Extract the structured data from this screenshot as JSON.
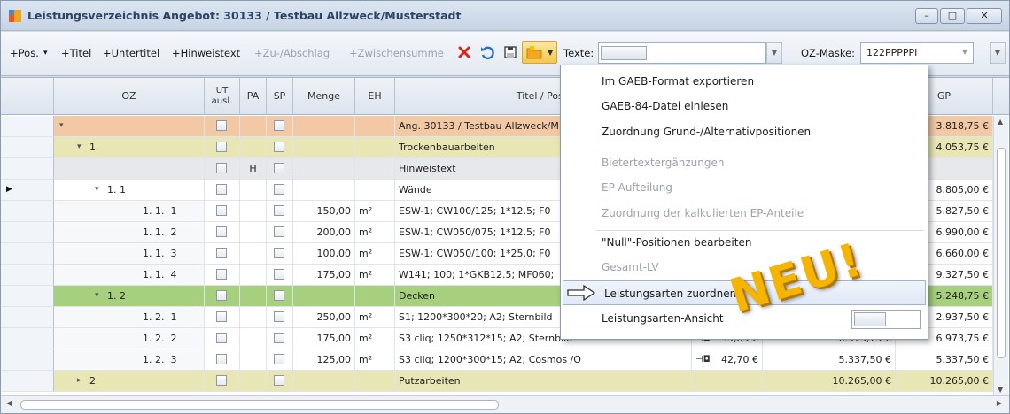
{
  "window": {
    "title": "Leistungsverzeichnis Angebot: 30133 / Testbau Allzweck/Musterstadt",
    "controls": {
      "minimize": "–",
      "maximize": "□",
      "close": "✕"
    }
  },
  "toolbar": {
    "items": [
      {
        "label": "+Pos.",
        "enabled": true
      },
      {
        "label": "▾",
        "enabled": true
      },
      {
        "label": "+Titel",
        "enabled": true
      },
      {
        "label": "+Untertitel",
        "enabled": true
      },
      {
        "label": "+Hinweistext",
        "enabled": true
      },
      {
        "label": "+Zu-/Abschlag",
        "enabled": false
      },
      {
        "label": "+Zwischensumme",
        "enabled": false
      }
    ],
    "icons": [
      "delete-icon",
      "undo-icon",
      "save-icon",
      "folder-icon"
    ],
    "texte_label": "Texte:",
    "texte_value": "",
    "oz_maske_label": "OZ-Maske:",
    "oz_maske_value": "122PPPPPI"
  },
  "columns": {
    "oz": "OZ",
    "ut_ausl": "UT\nausl.",
    "pa": "PA",
    "sp": "SP",
    "menge": "Menge",
    "eh": "EH",
    "titel": "Titel / Posit",
    "gp": "GP"
  },
  "rows": [
    {
      "oz": "",
      "expander": "▾",
      "level": 0,
      "menge": "",
      "eh": "",
      "titel": "Ang. 30133 / Testbau Allzweck/M",
      "ep": "",
      "gp_mid": "",
      "gp": "3.818,75 €",
      "pa": "",
      "bg": "#f2c9a4"
    },
    {
      "oz": "1",
      "expander": "▾",
      "level": 1,
      "menge": "",
      "eh": "",
      "titel": "Trockenbauarbeiten",
      "ep": "",
      "gp_mid": "",
      "gp": "4.053,75 €",
      "pa": "",
      "bg": "#e8e6b4"
    },
    {
      "oz": "",
      "expander": "",
      "level": 2,
      "menge": "",
      "eh": "",
      "titel": "Hinweistext",
      "ep": "",
      "gp_mid": "",
      "gp": "",
      "pa": "H",
      "bg": "#e6e8ec"
    },
    {
      "oz": "1. 1",
      "expander": "▾",
      "level": 2,
      "menge": "",
      "eh": "",
      "titel": "Wände",
      "ep": "",
      "gp_mid": "",
      "gp": "8.805,00 €",
      "pa": "",
      "bg": "#ffffff",
      "current": true
    },
    {
      "oz": "1. 1.  1",
      "expander": "",
      "level": 3,
      "menge": "150,00",
      "eh": "m²",
      "titel": "ESW-1; CW100/125; 1*12.5; F0",
      "ep": "",
      "gp_mid": "",
      "gp": "5.827,50 €",
      "pa": "",
      "bg": "#f7f8fa"
    },
    {
      "oz": "1. 1.  2",
      "expander": "",
      "level": 3,
      "menge": "200,00",
      "eh": "m²",
      "titel": "ESW-1; CW050/075; 1*12.5; F0",
      "ep": "",
      "gp_mid": "",
      "gp": "6.990,00 €",
      "pa": "",
      "bg": "#f7f8fa"
    },
    {
      "oz": "1. 1.  3",
      "expander": "",
      "level": 3,
      "menge": "100,00",
      "eh": "m²",
      "titel": "ESW-1; CW050/100; 1*25.0; F0",
      "ep": "",
      "gp_mid": "",
      "gp": "6.660,00 €",
      "pa": "",
      "bg": "#f7f8fa"
    },
    {
      "oz": "1. 1.  4",
      "expander": "",
      "level": 3,
      "menge": "175,00",
      "eh": "m²",
      "titel": "W141; 100; 1*GKB12.5; MF060;",
      "ep": "",
      "gp_mid": "",
      "gp": "9.327,50 €",
      "pa": "",
      "bg": "#f7f8fa"
    },
    {
      "oz": "1. 2",
      "expander": "▾",
      "level": 2,
      "menge": "",
      "eh": "",
      "titel": "Decken",
      "ep": "",
      "gp_mid": "",
      "gp": "5.248,75 €",
      "pa": "",
      "bg": "#a6cf7e"
    },
    {
      "oz": "1. 2.  1",
      "expander": "",
      "level": 3,
      "menge": "250,00",
      "eh": "m²",
      "titel": "S1; 1200*300*20; A2; Sternbild",
      "ep": "",
      "gp_mid": "",
      "gp": "2.937,50 €",
      "pa": "",
      "bg": "#f7f8fa"
    },
    {
      "oz": "1. 2.  2",
      "expander": "",
      "level": 3,
      "menge": "175,00",
      "eh": "m²",
      "titel": "S3 cliq; 1250*312*15; A2; Sternbild",
      "ep": "39,85 €",
      "gp_mid": "6.973,75 €",
      "gp": "6.973,75 €",
      "pa": "",
      "bg": "#f7f8fa"
    },
    {
      "oz": "1. 2.  3",
      "expander": "",
      "level": 3,
      "menge": "125,00",
      "eh": "m²",
      "titel": "S3 cliq; 1200*300*15; A2; Cosmos /O",
      "ep": "42,70 €",
      "gp_mid": "5.337,50 €",
      "gp": "5.337,50 €",
      "pa": "",
      "bg": "#f7f8fa"
    },
    {
      "oz": "2",
      "expander": "▸",
      "level": 1,
      "menge": "",
      "eh": "",
      "titel": "Putzarbeiten",
      "ep": "",
      "gp_mid": "10.265,00 €",
      "gp": "10.265,00 €",
      "pa": "",
      "bg": "#e8e6b4"
    }
  ],
  "menu": {
    "items": [
      {
        "label": "Im GAEB-Format exportieren",
        "enabled": true
      },
      {
        "label": "GAEB-84-Datei einlesen",
        "enabled": true
      },
      {
        "label": "Zuordnung Grund-/Alternativpositionen",
        "enabled": true
      },
      {
        "label": "Bietertextergänzungen",
        "enabled": false
      },
      {
        "label": "EP-Aufteilung",
        "enabled": false
      },
      {
        "label": "Zuordnung der kalkulierten EP-Anteile",
        "enabled": false
      },
      {
        "label": "\"Null\"-Positionen bearbeiten",
        "enabled": true
      },
      {
        "label": "Gesamt-LV",
        "enabled": false
      },
      {
        "label": "Leistungsarten zuordnen",
        "enabled": true,
        "highlighted": true
      },
      {
        "label": "Leistungsarten-Ansicht",
        "enabled": true
      }
    ]
  },
  "badge": "NEU!"
}
